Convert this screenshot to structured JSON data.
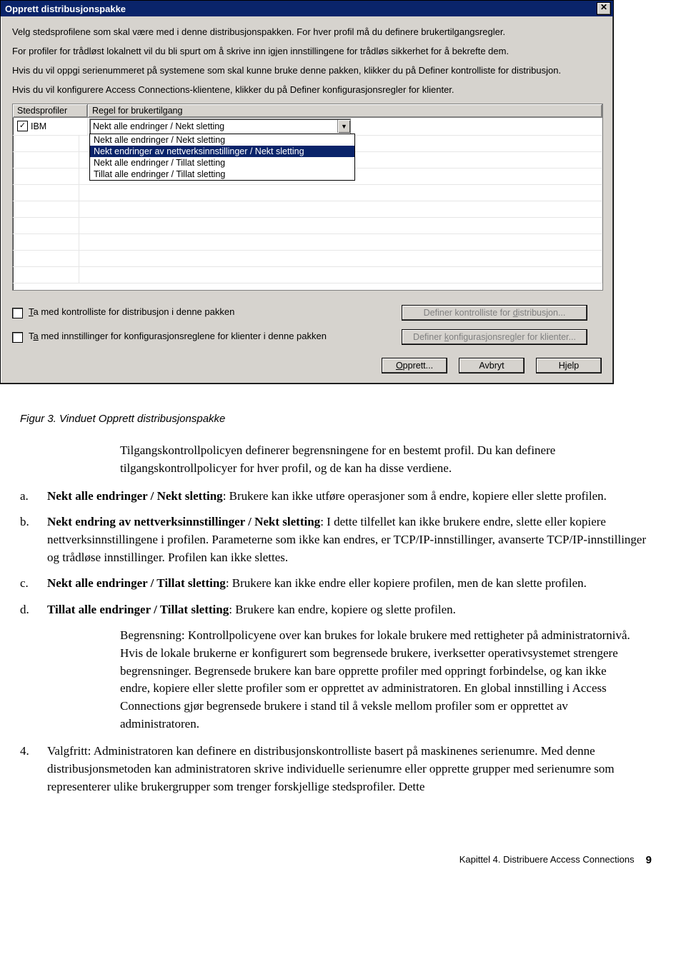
{
  "dialog": {
    "title": "Opprett distribusjonspakke",
    "close_glyph": "✕",
    "intro": {
      "p1": "Velg stedsprofilene som skal være med i denne distribusjonspakken. For hver profil må du definere brukertilgangsregler.",
      "p2": "For profiler for trådløst lokalnett vil du bli spurt om å skrive inn igjen innstillingene for trådløs sikkerhet for å bekrefte dem.",
      "p3": "Hvis du vil oppgi serienummeret på systemene som skal kunne bruke denne pakken, klikker du på Definer kontrolliste for distribusjon.",
      "p4": "Hvis du vil konfigurere Access Connections-klientene, klikker du på Definer konfigurasjonsregler for klienter."
    },
    "columns": {
      "steds": "Stedsprofiler",
      "regel": "Regel for brukertilgang"
    },
    "row": {
      "profile": "IBM",
      "checked": true
    },
    "combo": {
      "selected_text": "Nekt alle endringer / Nekt sletting",
      "options": [
        "Nekt alle endringer / Nekt sletting",
        "Nekt endringer av nettverksinnstillinger / Nekt sletting",
        "Nekt alle endringer / Tillat sletting",
        "Tillat alle endringer / Tillat sletting"
      ],
      "highlighted_index": 1
    },
    "checkbox1_label": "Ta med kontrolliste for distribusjon i denne pakken",
    "checkbox2_label": "Ta med innstillinger for konfigurasjonsreglene for klienter i denne pakken",
    "btn_define_dist": "Definer kontrolliste for distribusjon...",
    "btn_define_conf": "Definer konfigurasjonsregler for klienter...",
    "btn_create": "Opprett...",
    "btn_cancel": "Avbryt",
    "btn_help": "Hjelp"
  },
  "doc": {
    "caption_prefix": "Figur 3.",
    "caption_text": "Vinduet Opprett distribusjonspakke",
    "lead_para": "Tilgangskontrollpolicyen definerer begrensningene for en bestemt profil. Du kan definere tilgangskontrollpolicyer for hver profil, og de kan ha disse verdiene.",
    "a_label": "a.",
    "a_bold": "Nekt alle endringer / Nekt sletting",
    "a_rest": ": Brukere kan ikke utføre operasjoner som å endre, kopiere eller slette profilen.",
    "b_label": "b.",
    "b_bold": "Nekt endring av nettverksinnstillinger / Nekt sletting",
    "b_rest": ": I dette tilfellet kan ikke brukere endre, slette eller kopiere nettverksinnstillingene i profilen. Parameterne som ikke kan endres, er TCP/IP-innstillinger, avanserte TCP/IP-innstillinger og trådløse innstillinger. Profilen kan ikke slettes.",
    "c_label": "c.",
    "c_bold": "Nekt alle endringer / Tillat sletting",
    "c_rest": ": Brukere kan ikke endre eller kopiere profilen, men de kan slette profilen.",
    "d_label": "d.",
    "d_bold": "Tillat alle endringer / Tillat sletting",
    "d_rest": ": Brukere kan endre, kopiere og slette profilen.",
    "restriction_para": "Begrensning: Kontrollpolicyene over kan brukes for lokale brukere med rettigheter på administratornivå. Hvis de lokale brukerne er konfigurert som begrensede brukere, iverksetter operativsystemet strengere begrensninger. Begrensede brukere kan bare opprette profiler med oppringt forbindelse, og kan ikke endre, kopiere eller slette profiler som er opprettet av administratoren. En global innstilling i Access Connections gjør begrensede brukere i stand til å veksle mellom profiler som er opprettet av administratoren.",
    "num4_label": "4.",
    "num4_text": "Valgfritt: Administratoren kan definere en distribusjonskontrolliste basert på maskinenes serienumre. Med denne distribusjonsmetoden kan administratoren skrive individuelle serienumre eller opprette grupper med serienumre som representerer ulike brukergrupper som trenger forskjellige stedsprofiler. Dette",
    "footer_chapter": "Kapittel 4. Distribuere Access Connections",
    "footer_page": "9"
  }
}
